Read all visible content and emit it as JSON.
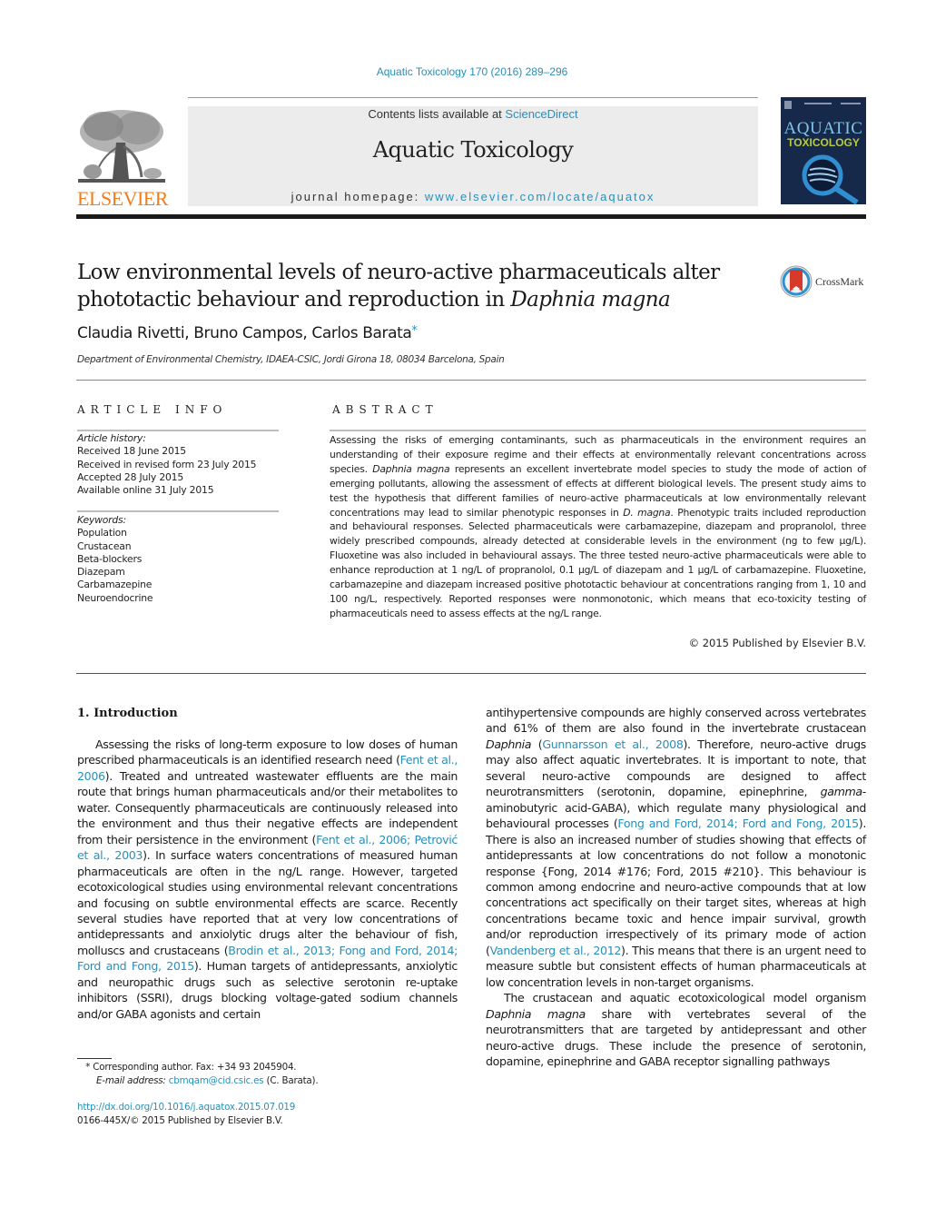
{
  "header": {
    "citation": "Aquatic Toxicology 170 (2016) 289–296",
    "contents_prefix": "Contents lists available at ",
    "contents_link": "ScienceDirect",
    "journal_name": "Aquatic Toxicology",
    "homepage_prefix": "journal homepage: ",
    "homepage_link": "www.elsevier.com/locate/aquatox",
    "publisher_logo_text": "ELSEVIER",
    "cover_title_line1": "AQUATIC",
    "cover_title_line2": "TOXICOLOGY",
    "crossmark_label": "CrossMark",
    "colors": {
      "link": "#2a8fb8",
      "elsevier_orange": "#f07d1b",
      "cover_bg": "#17294a"
    }
  },
  "article": {
    "title_line1": "Low environmental levels of neuro-active pharmaceuticals alter",
    "title_line2_prefix": "phototactic behaviour and reproduction in ",
    "title_line2_italic": "Daphnia magna",
    "authors": "Claudia Rivetti, Bruno Campos, Carlos Barata",
    "author_mark": "*",
    "affiliation": "Department of Environmental Chemistry, IDAEA-CSIC, Jordi Girona 18, 08034 Barcelona, Spain"
  },
  "article_info": {
    "heading": "ARTICLE INFO",
    "history_label": "Article history:",
    "history": [
      "Received 18 June 2015",
      "Received in revised form 23 July 2015",
      "Accepted 28 July 2015",
      "Available online 31 July 2015"
    ],
    "keywords_label": "Keywords:",
    "keywords": [
      "Population",
      "Crustacean",
      "Beta-blockers",
      "Diazepam",
      "Carbamazepine",
      "Neuroendocrine"
    ]
  },
  "abstract": {
    "heading": "ABSTRACT",
    "s1": "Assessing the risks of emerging contaminants, such as pharmaceuticals in the environment requires an understanding of their exposure regime and their effects at environmentally relevant concentrations across species. ",
    "s2_italic": "Daphnia magna",
    "s3": " represents an excellent invertebrate model species to study the mode of action of emerging pollutants, allowing the assessment of effects at different biological levels. The present study aims to test the hypothesis that different families of neuro-active pharmaceuticals at low environmentally relevant concentrations may lead to similar phenotypic responses in ",
    "s4_italic": "D. magna",
    "s5": ". Phenotypic traits included reproduction and behavioural responses. Selected pharmaceuticals were carbamazepine, diazepam and propranolol, three widely prescribed compounds, already detected at considerable levels in the environment (ng to few µg/L). Fluoxetine was also included in behavioural assays. The three tested neuro-active pharmaceuticals were able to enhance reproduction at 1 ng/L of propranolol, 0.1 µg/L of diazepam and 1 µg/L of carbamazepine. Fluoxetine, carbamazepine and diazepam increased positive phototactic behaviour at concentrations ranging from 1, 10 and 100 ng/L, respectively. Reported responses were nonmonotonic, which means that eco-toxicity testing of pharmaceuticals need to assess effects at the ng/L range.",
    "copyright": "© 2015 Published by Elsevier B.V."
  },
  "introduction": {
    "heading": "1.  Introduction",
    "left": {
      "t1": "Assessing the risks of long-term exposure to low doses of human prescribed pharmaceuticals is an identified research need (",
      "c1": "Fent et al., 2006",
      "t2": "). Treated and untreated wastewater effluents are the main route that brings human pharmaceuticals and/or their metabolites to water. Consequently pharmaceuticals are continuously released into the environment and thus their negative effects are independent from their persistence in the environment (",
      "c2": "Fent et al., 2006; Petrović et al., 2003",
      "t3": "). In surface waters concentrations of measured human pharmaceuticals are often in the ng/L range. However, targeted ecotoxicological studies using environmental relevant concentrations and focusing on subtle environmental effects are scarce. Recently several studies have reported that at very low concentrations of antidepressants and anxiolytic drugs alter the behaviour of fish, molluscs and crustaceans (",
      "c3": "Brodin et al., 2013; Fong and Ford, 2014; Ford and Fong, 2015",
      "t4": "). Human targets of antidepressants, anxiolytic and neuropathic drugs such as selective serotonin re-uptake inhibitors (SSRI), drugs blocking voltage-gated sodium channels and/or GABA agonists and certain"
    },
    "right": {
      "t1": "antihypertensive compounds are highly conserved across vertebrates and 61% of them are also found in the invertebrate crustacean ",
      "i1": "Daphnia",
      "t1b": " (",
      "c1": "Gunnarsson et al., 2008",
      "t2": "). Therefore, neuro-active drugs may also affect aquatic invertebrates. It is important to note, that several neuro-active compounds are designed to affect neurotransmitters (serotonin, dopamine, epinephrine, ",
      "i2": "gamma",
      "t3": "-aminobutyric acid-GABA), which regulate many physiological and behavioural processes (",
      "c2": "Fong and Ford, 2014; Ford and Fong, 2015",
      "t4": "). There is also an increased number of studies showing that effects of antidepressants at low concentrations do not follow a monotonic response {Fong, 2014 #176; Ford, 2015 #210}. This behaviour is common among endocrine and neuro-active compounds that at low concentrations act specifically on their target sites, whereas at high concentrations became toxic and hence impair survival, growth and/or reproduction irrespectively of its primary mode of action (",
      "c3": "Vandenberg et al., 2012",
      "t5": "). This means that there is an urgent need to measure subtle but consistent effects of human pharmaceuticals at low concentration levels in non-target organisms.",
      "p2_i1": "Daphnia magna",
      "p2_t1": "The crustacean and aquatic ecotoxicological model organism ",
      "p2_t2": " share with vertebrates several of the neurotransmitters that are targeted by antidepressant and other neuro-active drugs. These include the presence of serotonin, dopamine, epinephrine and GABA receptor signalling pathways"
    }
  },
  "footnotes": {
    "star": "*",
    "corresponding": " Corresponding author. Fax: +34 93 2045904.",
    "email_label": "E-mail address: ",
    "email": "cbmqam@cid.csic.es",
    "email_suffix": " (C. Barata).",
    "doi": "http://dx.doi.org/10.1016/j.aquatox.2015.07.019",
    "issn": "0166-445X/© 2015 Published by Elsevier B.V."
  }
}
